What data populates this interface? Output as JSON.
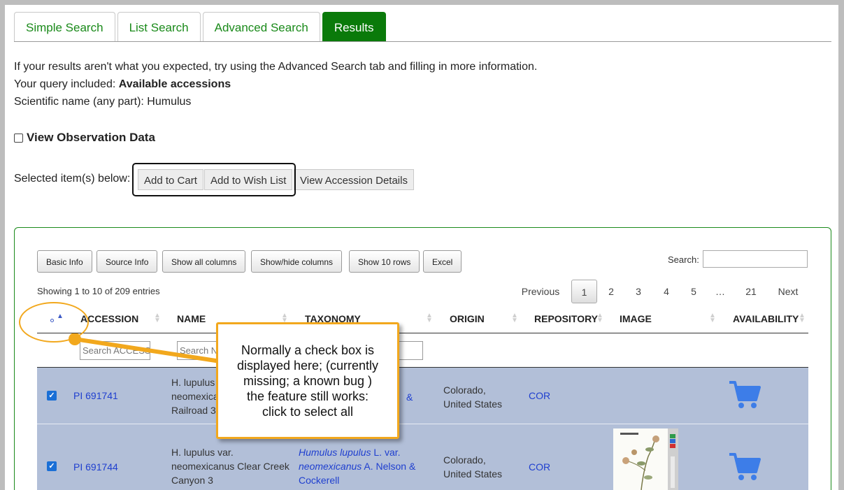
{
  "tabs": [
    {
      "label": "Simple Search",
      "active": false
    },
    {
      "label": "List Search",
      "active": false
    },
    {
      "label": "Advanced Search",
      "active": false
    },
    {
      "label": "Results",
      "active": true
    }
  ],
  "info": {
    "line1": "If your results aren't what you expected, try using the Advanced Search tab and filling in more information.",
    "query_prefix": "Your query included: ",
    "query_value": "Available accessions",
    "line3": "Scientific name (any part): Humulus"
  },
  "view_observation": {
    "label": "View Observation Data",
    "checked": false
  },
  "selection": {
    "label": "Selected item(s) below:",
    "add_to_cart": "Add to Cart",
    "add_to_wish_list": "Add to Wish List",
    "view_details": "View Accession Details"
  },
  "toolbar": {
    "basic_info": "Basic Info",
    "source_info": "Source Info",
    "show_all": "Show all columns",
    "show_hide": "Show/hide columns",
    "show_10": "Show 10 rows",
    "excel": "Excel",
    "search_label": "Search:"
  },
  "table_info": {
    "showing": "Showing 1 to 10 of 209 entries"
  },
  "pagination": {
    "previous": "Previous",
    "pages": [
      "1",
      "2",
      "3",
      "4",
      "5",
      "…",
      "21"
    ],
    "current": "1",
    "next": "Next"
  },
  "columns": [
    "ACCESSION",
    "NAME",
    "TAXONOMY",
    "ORIGIN",
    "REPOSITORY",
    "IMAGE",
    "AVAILABILITY"
  ],
  "filters": {
    "accession_placeholder": "Search ACCESS",
    "name_placeholder": "Search N"
  },
  "rows": [
    {
      "checked": true,
      "accession": "PI 691741",
      "name_lines": [
        "H. lupulus",
        "neomexica",
        "Railroad 3"
      ],
      "taxonomy_visible": "&",
      "origin_lines": [
        "Colorado,",
        "United States"
      ],
      "repository": "COR",
      "has_image": false
    },
    {
      "checked": true,
      "accession": "PI 691744",
      "name_lines": [
        "H. lupulus var.",
        "neomexicanus Clear Creek",
        "Canyon 3"
      ],
      "taxonomy": {
        "genus_species": "Humulus lupulus",
        "author": " L. var.",
        "variety": "neomexicanus",
        "authors2": " A. Nelson &",
        "authors3": "Cockerell"
      },
      "origin_lines": [
        "Colorado,",
        "United States"
      ],
      "repository": "COR",
      "has_image": true
    }
  ],
  "callout": {
    "text": "Normally a check box is displayed here; (currently missing; a known bug ) the feature still works: click to select all"
  },
  "colors": {
    "accent_green": "#0a7a0a",
    "row_selected": "#b2bfd8",
    "cart_blue": "#3d7de8",
    "callout_border": "#f2a81d"
  }
}
